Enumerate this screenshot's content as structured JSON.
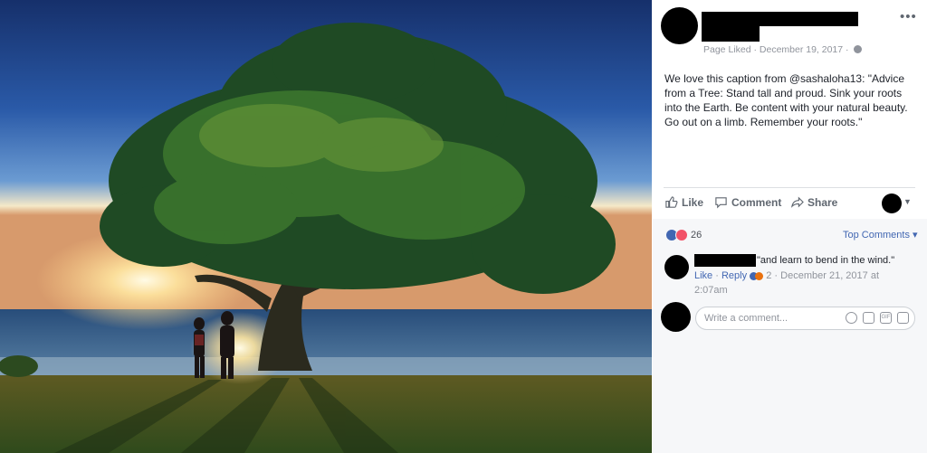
{
  "photo": {
    "alt_subject": "tree-by-ocean-sunset"
  },
  "post": {
    "page_status": "Page Liked",
    "separator": "·",
    "date": "December 19, 2017",
    "caption": "We love this caption from @sashaloha13: \"Advice from a Tree: Stand tall and proud. Sink your roots into the Earth. Be content with your natural beauty. Go out on a limb. Remember your roots.\"",
    "more_label": "•••"
  },
  "actions": {
    "like": "Like",
    "comment": "Comment",
    "share": "Share"
  },
  "reactions": {
    "count": "26",
    "sort_label": "Top Comments ▾"
  },
  "comment": {
    "text": "\"and learn to bend in the wind.\"",
    "like": "Like",
    "reply": "Reply",
    "reaction_count": "2",
    "timestamp": "December 21, 2017 at 2:07am"
  },
  "composer": {
    "placeholder": "Write a comment..."
  },
  "colors": {
    "link": "#4267b2",
    "muted": "#90949c",
    "text": "#1d2129"
  }
}
